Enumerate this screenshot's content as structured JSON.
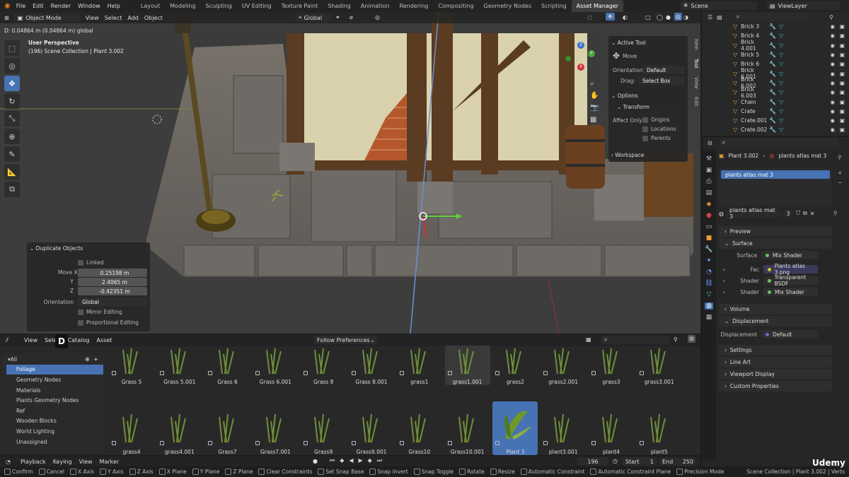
{
  "topbar": {
    "menus": [
      "File",
      "Edit",
      "Render",
      "Window",
      "Help"
    ],
    "workspaces": [
      "Layout",
      "Modeling",
      "Sculpting",
      "UV Editing",
      "Texture Paint",
      "Shading",
      "Animation",
      "Rendering",
      "Compositing",
      "Geometry Nodes",
      "Scripting",
      "Asset Manager"
    ],
    "active_workspace": "Asset Manager",
    "scene": "Scene",
    "view_layer": "ViewLayer"
  },
  "viewport": {
    "mode": "Object Mode",
    "menus": [
      "View",
      "Select",
      "Add",
      "Object"
    ],
    "orientation": "Global",
    "status_line": "D: 0.04864 m (0.04864 m) global",
    "info_title": "User Perspective",
    "info_sub": "(196) Scene Collection | Plant 3.002",
    "side_tabs": [
      "Item",
      "Tool",
      "View",
      "Edit"
    ],
    "gizmo_axes": [
      "Z",
      "Y",
      "X"
    ]
  },
  "active_tool": {
    "title": "Active Tool",
    "tool": "Move",
    "orientation_label": "Orientation",
    "orientation_value": "Default",
    "drag_label": "Drag:",
    "drag_value": "Select Box",
    "options_title": "Options",
    "transform_title": "Transform",
    "affect_only": "Affect Only",
    "checks": [
      "Origins",
      "Locations",
      "Parents"
    ],
    "workspace_title": "Workspace"
  },
  "redo_panel": {
    "title": "Duplicate Objects",
    "linked": "Linked",
    "move_x_label": "Move X",
    "move_x": "0.25198 m",
    "y_label": "Y",
    "y": "2.4065 m",
    "z_label": "Z",
    "z": "-0.42351 m",
    "orientation_label": "Orientation",
    "orientation": "Global",
    "mirror": "Mirror Editing",
    "proportional": "Proportional Editing"
  },
  "outliner": {
    "rows": [
      "Brick 3",
      "Brick 4",
      "Brick 4.001",
      "Brick 5",
      "Brick 6",
      "Brick 6.001",
      "Brick 6.002",
      "Brick 6.003",
      "Chain",
      "Crate",
      "Crate.001",
      "Crate.002"
    ]
  },
  "properties": {
    "breadcrumb_object": "Plant 3.002",
    "breadcrumb_material": "plants atlas mat 3",
    "slot": "plants atlas mat 3",
    "material_name": "plants atlas mat 3",
    "users": "3",
    "sections": {
      "preview": "Preview",
      "surface": "Surface",
      "volume": "Volume",
      "displacement": "Displacement",
      "settings": "Settings",
      "line_art": "Line Art",
      "viewport_display": "Viewport Display",
      "custom_properties": "Custom Properties"
    },
    "surface_rows": [
      {
        "key": "Surface",
        "value": "Mix Shader"
      },
      {
        "key": "Fac",
        "value": "Plants atlas 3.png"
      },
      {
        "key": "Shader",
        "value": "Transparent BSDF"
      },
      {
        "key": "Shader",
        "value": "Mix Shader"
      }
    ],
    "displacement_row": {
      "key": "Displacement",
      "value": "Default"
    }
  },
  "asset_browser": {
    "menus": [
      "View",
      "Select",
      "Catalog",
      "Asset"
    ],
    "library": "Follow Preferences",
    "key_overlay": "D",
    "catalogs": [
      "All",
      "Foliage",
      "Geometry Nodes",
      "Materials",
      "Plants Geometry Nodes",
      "Ref",
      "Wooden Blocks",
      "World Lighting",
      "Unassigned"
    ],
    "selected_catalog": "Foliage",
    "assets_row1": [
      "Grass 5",
      "Grass 5.001",
      "Grass 6",
      "Grass 6.001",
      "Grass 8",
      "Grass 8.001",
      "grass1",
      "grass1.001",
      "grass2",
      "grass2.001",
      "grass3",
      "grass3.001"
    ],
    "assets_row2": [
      "grass4",
      "grass4.001",
      "Grass7",
      "Grass7.001",
      "Grass9",
      "Grass9.001",
      "Grass10",
      "Grass10.001",
      "Plant 3",
      "plant3.001",
      "plant4",
      "plant5"
    ],
    "selected_asset": "Plant 3",
    "hovered_asset": "grass1.001"
  },
  "timeline": {
    "menus": [
      "Playback",
      "Keying",
      "View",
      "Marker"
    ],
    "current_frame": "196",
    "start_label": "Start",
    "start": "1",
    "end_label": "End",
    "end": "250"
  },
  "statusbar": {
    "items": [
      "Confirm",
      "Cancel",
      "X Axis",
      "Y Axis",
      "Z Axis",
      "X Plane",
      "Y Plane",
      "Z Plane",
      "Clear Constraints",
      "Set Snap Base",
      "Snap Invert",
      "Snap Toggle",
      "Rotate",
      "Resize",
      "Automatic Constraint",
      "Automatic Constraint Plane",
      "Precision Mode"
    ],
    "right": "Scene Collection | Plant 3.002 | Verts",
    "watermark": "Udemy"
  }
}
